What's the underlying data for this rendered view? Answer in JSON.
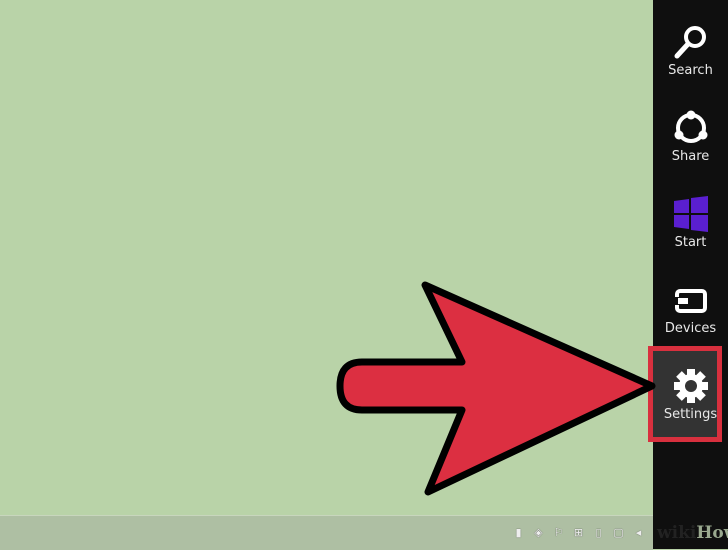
{
  "charms": [
    {
      "label": "Search",
      "icon": "search-icon"
    },
    {
      "label": "Share",
      "icon": "share-icon"
    },
    {
      "label": "Start",
      "icon": "windows-logo-icon"
    },
    {
      "label": "Devices",
      "icon": "devices-icon"
    },
    {
      "label": "Settings",
      "icon": "gear-icon",
      "highlighted": true
    }
  ],
  "tray_icons": [
    "usb-safe-remove-icon",
    "virtualbox-icon",
    "action-center-flag-icon",
    "windows-icon",
    "network-icon",
    "display-icon",
    "volume-icon"
  ],
  "watermark": {
    "wiki": "wiki",
    "how": "How"
  },
  "colors": {
    "desktop": "#b9d3a8",
    "charms_bar": "#0f0f0f",
    "highlight": "#d8303e",
    "start_tile": "#5a1fd0",
    "arrow": "#dc2f41"
  }
}
